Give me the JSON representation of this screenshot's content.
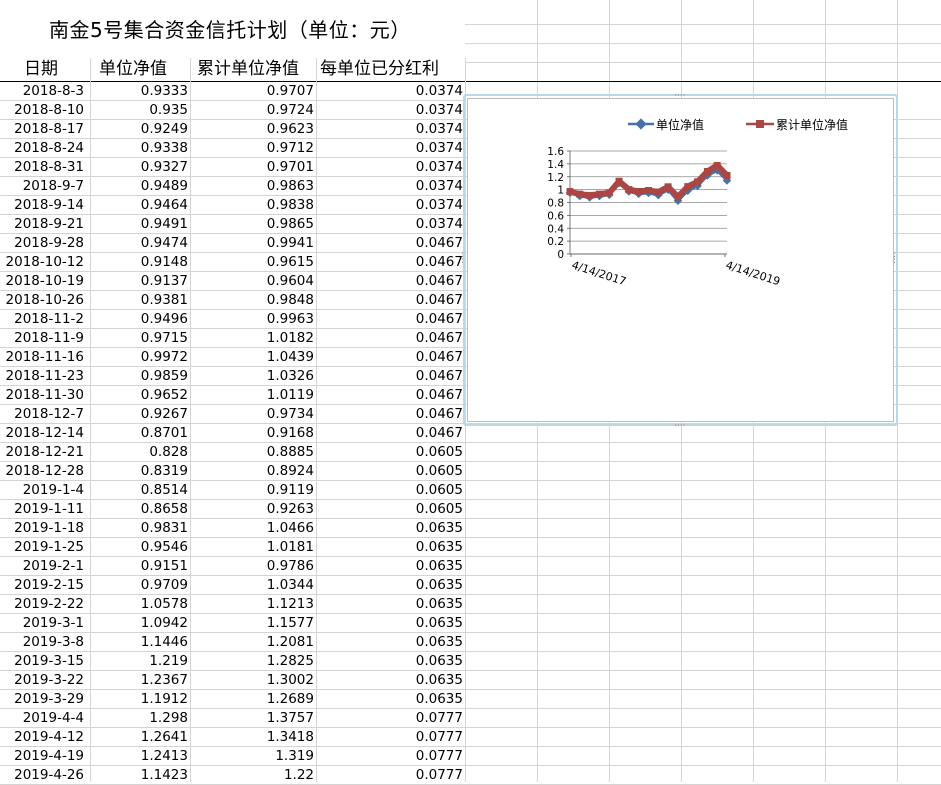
{
  "sheet": {
    "title": "南金5号集合资金信托计划（单位：元）",
    "headers": [
      "日期",
      "单位净值",
      "累计单位净值",
      "每单位已分红利"
    ],
    "rows": [
      [
        "2018-8-3",
        "0.9333",
        "0.9707",
        "0.0374"
      ],
      [
        "2018-8-10",
        "0.935",
        "0.9724",
        "0.0374"
      ],
      [
        "2018-8-17",
        "0.9249",
        "0.9623",
        "0.0374"
      ],
      [
        "2018-8-24",
        "0.9338",
        "0.9712",
        "0.0374"
      ],
      [
        "2018-8-31",
        "0.9327",
        "0.9701",
        "0.0374"
      ],
      [
        "2018-9-7",
        "0.9489",
        "0.9863",
        "0.0374"
      ],
      [
        "2018-9-14",
        "0.9464",
        "0.9838",
        "0.0374"
      ],
      [
        "2018-9-21",
        "0.9491",
        "0.9865",
        "0.0374"
      ],
      [
        "2018-9-28",
        "0.9474",
        "0.9941",
        "0.0467"
      ],
      [
        "2018-10-12",
        "0.9148",
        "0.9615",
        "0.0467"
      ],
      [
        "2018-10-19",
        "0.9137",
        "0.9604",
        "0.0467"
      ],
      [
        "2018-10-26",
        "0.9381",
        "0.9848",
        "0.0467"
      ],
      [
        "2018-11-2",
        "0.9496",
        "0.9963",
        "0.0467"
      ],
      [
        "2018-11-9",
        "0.9715",
        "1.0182",
        "0.0467"
      ],
      [
        "2018-11-16",
        "0.9972",
        "1.0439",
        "0.0467"
      ],
      [
        "2018-11-23",
        "0.9859",
        "1.0326",
        "0.0467"
      ],
      [
        "2018-11-30",
        "0.9652",
        "1.0119",
        "0.0467"
      ],
      [
        "2018-12-7",
        "0.9267",
        "0.9734",
        "0.0467"
      ],
      [
        "2018-12-14",
        "0.8701",
        "0.9168",
        "0.0467"
      ],
      [
        "2018-12-21",
        "0.828",
        "0.8885",
        "0.0605"
      ],
      [
        "2018-12-28",
        "0.8319",
        "0.8924",
        "0.0605"
      ],
      [
        "2019-1-4",
        "0.8514",
        "0.9119",
        "0.0605"
      ],
      [
        "2019-1-11",
        "0.8658",
        "0.9263",
        "0.0605"
      ],
      [
        "2019-1-18",
        "0.9831",
        "1.0466",
        "0.0635"
      ],
      [
        "2019-1-25",
        "0.9546",
        "1.0181",
        "0.0635"
      ],
      [
        "2019-2-1",
        "0.9151",
        "0.9786",
        "0.0635"
      ],
      [
        "2019-2-15",
        "0.9709",
        "1.0344",
        "0.0635"
      ],
      [
        "2019-2-22",
        "1.0578",
        "1.1213",
        "0.0635"
      ],
      [
        "2019-3-1",
        "1.0942",
        "1.1577",
        "0.0635"
      ],
      [
        "2019-3-8",
        "1.1446",
        "1.2081",
        "0.0635"
      ],
      [
        "2019-3-15",
        "1.219",
        "1.2825",
        "0.0635"
      ],
      [
        "2019-3-22",
        "1.2367",
        "1.3002",
        "0.0635"
      ],
      [
        "2019-3-29",
        "1.1912",
        "1.2689",
        "0.0635"
      ],
      [
        "2019-4-4",
        "1.298",
        "1.3757",
        "0.0777"
      ],
      [
        "2019-4-12",
        "1.2641",
        "1.3418",
        "0.0777"
      ],
      [
        "2019-4-19",
        "1.2413",
        "1.319",
        "0.0777"
      ],
      [
        "2019-4-26",
        "1.1423",
        "1.22",
        "0.0777"
      ]
    ]
  },
  "chart_data": {
    "type": "line",
    "title": "",
    "legend_position": "top",
    "yticks": [
      "0",
      "0.2",
      "0.4",
      "0.6",
      "0.8",
      "1",
      "1.2",
      "1.4",
      "1.6"
    ],
    "ylim": [
      0,
      1.6
    ],
    "grid": true,
    "x_tick_labels": [
      "4/14/2017",
      "4/14/2019"
    ],
    "x": [
      "4/14/2017",
      "2017-7-1",
      "2017-10-1",
      "2018-1-1",
      "2018-4-1",
      "2018-6-1",
      "2018-7-1",
      "2018-8-3",
      "2018-9-7",
      "2018-10-12",
      "2018-11-16",
      "2018-12-21",
      "2019-1-18",
      "2019-2-22",
      "2019-3-15",
      "2019-4-4",
      "2019-4-26"
    ],
    "series": [
      {
        "name": "单位净值",
        "color": "#4572a7",
        "values": [
          0.95,
          0.9,
          0.88,
          0.9,
          0.92,
          1.1,
          0.97,
          0.9333,
          0.9489,
          0.9148,
          0.9972,
          0.828,
          0.9831,
          1.0578,
          1.219,
          1.298,
          1.1423
        ]
      },
      {
        "name": "累计单位净值",
        "color": "#aa4643",
        "values": [
          0.97,
          0.93,
          0.91,
          0.93,
          0.95,
          1.13,
          1.0,
          0.9707,
          0.9863,
          0.9615,
          1.0439,
          0.8885,
          1.0466,
          1.1213,
          1.2825,
          1.3757,
          1.22
        ]
      }
    ]
  }
}
